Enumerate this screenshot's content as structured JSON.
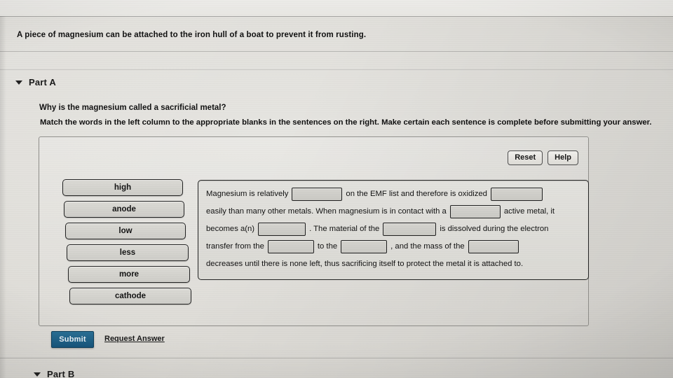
{
  "intro": {
    "text": "A piece of magnesium can be attached to the iron hull of a boat to prevent it from rusting."
  },
  "part_a": {
    "caret_icon": "caret-down-icon",
    "label": "Part A",
    "question": "Why is the magnesium called a sacrificial metal?",
    "instruction": "Match the words in the left column to the appropriate blanks in the sentences on the right. Make certain each sentence is complete before submitting your answer."
  },
  "part_b": {
    "caret_icon": "caret-down-icon",
    "label": "Part B"
  },
  "toolbar": {
    "reset_label": "Reset",
    "help_label": "Help"
  },
  "word_bank": {
    "tiles": [
      {
        "label": "high"
      },
      {
        "label": "anode"
      },
      {
        "label": "low"
      },
      {
        "label": "less"
      },
      {
        "label": "more"
      },
      {
        "label": "cathode"
      }
    ]
  },
  "sentence": {
    "segments": [
      {
        "type": "text",
        "value": "Magnesium is relatively"
      },
      {
        "type": "blank",
        "value": ""
      },
      {
        "type": "text",
        "value": "on the EMF list and therefore is oxidized"
      },
      {
        "type": "blank",
        "value": ""
      },
      {
        "type": "text",
        "value": "easily than many other metals. When magnesium is in contact with a"
      },
      {
        "type": "blank",
        "value": ""
      },
      {
        "type": "text",
        "value": "active metal, it"
      },
      {
        "type": "text",
        "value": "becomes a(n)"
      },
      {
        "type": "blank",
        "value": ""
      },
      {
        "type": "text",
        "value": ". The material of the"
      },
      {
        "type": "blank",
        "value": ""
      },
      {
        "type": "text",
        "value": "is dissolved during the electron"
      },
      {
        "type": "text",
        "value": "transfer from the"
      },
      {
        "type": "blank",
        "value": ""
      },
      {
        "type": "text",
        "value": "to the"
      },
      {
        "type": "blank",
        "value": ""
      },
      {
        "type": "text",
        "value": ", and the mass of the"
      },
      {
        "type": "blank",
        "value": ""
      },
      {
        "type": "text",
        "value": "decreases until there is none left, thus sacrificing itself to protect the metal it is attached to."
      }
    ],
    "lines": {
      "l1a": "Magnesium is relatively",
      "l1b": "on the EMF list and therefore is oxidized",
      "l2a": "easily than many other metals. When magnesium is in contact with a",
      "l2b": "active metal, it",
      "l3a": "becomes a(n)",
      "l3b": ". The material of the",
      "l3c": "is dissolved during the electron",
      "l4a": "transfer from the",
      "l4b": "to the",
      "l4c": ", and the mass of the",
      "l5a": "decreases until there is none left, thus sacrificing itself to protect the metal it is attached to."
    }
  },
  "footer": {
    "submit_label": "Submit",
    "request_answer_label": "Request Answer"
  },
  "colors": {
    "submit_blue": "#17567d",
    "page_background": "#dedcd7",
    "tile_fill": "#d4d3ce",
    "blank_fill": "#d0cfca",
    "border_dark": "#222222"
  }
}
